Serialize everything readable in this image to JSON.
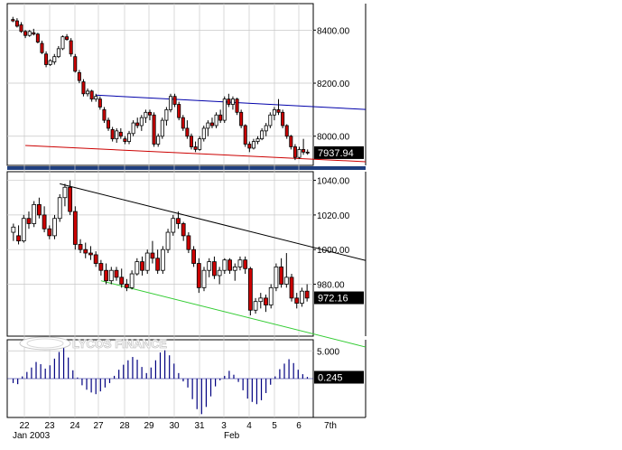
{
  "colors": {
    "background": "#ffffff",
    "grid": "#c8c8c8",
    "bear_candle": "#cc0000",
    "bull_candle": "#ffffff",
    "candle_outline": "#000000",
    "resistance_top": "#0000aa",
    "support_top": "#cc0000",
    "resistance_bottom": "#000000",
    "support_bottom": "#33cc33",
    "oscillator": "#000080",
    "price_tag_bg": "#000000",
    "panel_strip": "#1f3f7f"
  },
  "watermark": {
    "text": "LYCOS FINANCE",
    "icon": "lycos-logo-icon"
  },
  "chart_data": [
    {
      "type": "candlestick",
      "panel": "top",
      "title": "",
      "ylim": [
        7890,
        8500
      ],
      "y_ticks": [
        {
          "v": 8400,
          "label": "8400.00"
        },
        {
          "v": 8200,
          "label": "8200.00"
        },
        {
          "v": 8000,
          "label": "8000.00"
        }
      ],
      "last_value_label": "7937.94",
      "last_value": 7937.94,
      "ohlc": [
        [
          8440,
          8450,
          8430,
          8435
        ],
        [
          8435,
          8445,
          8410,
          8415
        ],
        [
          8420,
          8430,
          8390,
          8395
        ],
        [
          8395,
          8400,
          8370,
          8380
        ],
        [
          8380,
          8400,
          8375,
          8395
        ],
        [
          8390,
          8405,
          8380,
          8385
        ],
        [
          8385,
          8390,
          8350,
          8355
        ],
        [
          8350,
          8360,
          8310,
          8315
        ],
        [
          8310,
          8320,
          8260,
          8270
        ],
        [
          8270,
          8290,
          8265,
          8285
        ],
        [
          8280,
          8310,
          8270,
          8300
        ],
        [
          8300,
          8340,
          8295,
          8330
        ],
        [
          8330,
          8380,
          8325,
          8375
        ],
        [
          8375,
          8385,
          8360,
          8365
        ],
        [
          8360,
          8370,
          8300,
          8310
        ],
        [
          8300,
          8310,
          8240,
          8245
        ],
        [
          8240,
          8250,
          8200,
          8210
        ],
        [
          8205,
          8215,
          8150,
          8160
        ],
        [
          8160,
          8180,
          8150,
          8170
        ],
        [
          8170,
          8175,
          8130,
          8140
        ],
        [
          8140,
          8160,
          8130,
          8150
        ],
        [
          8140,
          8150,
          8100,
          8110
        ],
        [
          8100,
          8110,
          8050,
          8060
        ],
        [
          8060,
          8070,
          8020,
          8030
        ],
        [
          8025,
          8035,
          7980,
          7990
        ],
        [
          7990,
          8030,
          7975,
          8020
        ],
        [
          8015,
          8030,
          7990,
          8000
        ],
        [
          7990,
          8000,
          7970,
          7980
        ],
        [
          7980,
          8020,
          7970,
          8010
        ],
        [
          8010,
          8060,
          8000,
          8050
        ],
        [
          8050,
          8070,
          8030,
          8040
        ],
        [
          8040,
          8080,
          8020,
          8070
        ],
        [
          8070,
          8100,
          8050,
          8090
        ],
        [
          8090,
          8100,
          8060,
          8080
        ],
        [
          8080,
          8090,
          7960,
          7970
        ],
        [
          7970,
          8010,
          7960,
          8000
        ],
        [
          8000,
          8070,
          7990,
          8060
        ],
        [
          8060,
          8110,
          8040,
          8100
        ],
        [
          8100,
          8160,
          8090,
          8150
        ],
        [
          8150,
          8160,
          8110,
          8120
        ],
        [
          8120,
          8130,
          8060,
          8070
        ],
        [
          8070,
          8080,
          8020,
          8030
        ],
        [
          8030,
          8060,
          7990,
          8000
        ],
        [
          8000,
          8010,
          7950,
          7960
        ],
        [
          7960,
          7980,
          7940,
          7950
        ],
        [
          7950,
          8000,
          7945,
          7990
        ],
        [
          7990,
          8040,
          7980,
          8030
        ],
        [
          8030,
          8060,
          8000,
          8050
        ],
        [
          8050,
          8070,
          8030,
          8040
        ],
        [
          8040,
          8090,
          8030,
          8080
        ],
        [
          8080,
          8100,
          8050,
          8060
        ],
        [
          8060,
          8150,
          8050,
          8140
        ],
        [
          8140,
          8160,
          8110,
          8120
        ],
        [
          8120,
          8150,
          8100,
          8140
        ],
        [
          8140,
          8145,
          8080,
          8090
        ],
        [
          8090,
          8100,
          8030,
          8040
        ],
        [
          8040,
          8045,
          7960,
          7970
        ],
        [
          7970,
          7980,
          7940,
          7955
        ],
        [
          7955,
          7990,
          7950,
          7980
        ],
        [
          7980,
          8000,
          7970,
          7990
        ],
        [
          7990,
          8030,
          7985,
          8020
        ],
        [
          8020,
          8050,
          8000,
          8040
        ],
        [
          8040,
          8090,
          8030,
          8080
        ],
        [
          8080,
          8110,
          8060,
          8100
        ],
        [
          8100,
          8140,
          8080,
          8090
        ],
        [
          8090,
          8100,
          8030,
          8040
        ],
        [
          8040,
          8045,
          7990,
          8000
        ],
        [
          8000,
          8005,
          7950,
          7960
        ],
        [
          7960,
          7970,
          7910,
          7920
        ],
        [
          7920,
          7960,
          7915,
          7950
        ],
        [
          7950,
          7990,
          7930,
          7940
        ],
        [
          7940,
          7950,
          7930,
          7938
        ]
      ],
      "trend_lines": [
        {
          "name": "resistance",
          "from": [
            20,
            8155
          ],
          "to": [
            74,
            8110
          ],
          "color": "#0000aa"
        },
        {
          "name": "support",
          "from": [
            3,
            7965
          ],
          "to": [
            74,
            7912
          ],
          "color": "#cc0000"
        }
      ]
    },
    {
      "type": "candlestick",
      "panel": "middle",
      "title": "",
      "ylim": [
        950,
        1045
      ],
      "y_ticks": [
        {
          "v": 1040,
          "label": "1040.00"
        },
        {
          "v": 1020,
          "label": "1020.00"
        },
        {
          "v": 1000,
          "label": "1000.00"
        },
        {
          "v": 980,
          "label": "980.00"
        }
      ],
      "last_value_label": "972.16",
      "last_value": 972.16,
      "ohlc": [
        [
          1010,
          1015,
          1005,
          1013
        ],
        [
          1008,
          1014,
          1003,
          1005
        ],
        [
          1005,
          1020,
          1004,
          1018
        ],
        [
          1018,
          1022,
          1012,
          1015
        ],
        [
          1015,
          1028,
          1013,
          1026
        ],
        [
          1026,
          1030,
          1018,
          1020
        ],
        [
          1020,
          1025,
          1010,
          1012
        ],
        [
          1012,
          1014,
          1006,
          1008
        ],
        [
          1008,
          1020,
          1006,
          1018
        ],
        [
          1018,
          1032,
          1016,
          1030
        ],
        [
          1030,
          1038,
          1025,
          1036
        ],
        [
          1036,
          1040,
          1020,
          1022
        ],
        [
          1022,
          1025,
          1000,
          1003
        ],
        [
          1003,
          1006,
          998,
          1000
        ],
        [
          1000,
          1004,
          995,
          998
        ],
        [
          998,
          1002,
          994,
          997
        ],
        [
          997,
          999,
          990,
          992
        ],
        [
          992,
          994,
          985,
          988
        ],
        [
          988,
          992,
          980,
          982
        ],
        [
          982,
          990,
          980,
          988
        ],
        [
          988,
          990,
          982,
          984
        ],
        [
          984,
          989,
          978,
          980
        ],
        [
          980,
          983,
          976,
          978
        ],
        [
          978,
          988,
          977,
          986
        ],
        [
          986,
          995,
          985,
          993
        ],
        [
          993,
          996,
          985,
          988
        ],
        [
          988,
          1000,
          986,
          998
        ],
        [
          998,
          1005,
          992,
          995
        ],
        [
          995,
          1000,
          986,
          988
        ],
        [
          988,
          1002,
          986,
          1000
        ],
        [
          1000,
          1012,
          998,
          1010
        ],
        [
          1010,
          1020,
          1008,
          1018
        ],
        [
          1018,
          1022,
          1012,
          1015
        ],
        [
          1015,
          1016,
          1005,
          1008
        ],
        [
          1008,
          1010,
          998,
          1000
        ],
        [
          1000,
          1002,
          990,
          992
        ],
        [
          992,
          995,
          975,
          978
        ],
        [
          978,
          990,
          976,
          988
        ],
        [
          988,
          995,
          984,
          993
        ],
        [
          993,
          996,
          983,
          985
        ],
        [
          985,
          990,
          980,
          988
        ],
        [
          988,
          995,
          986,
          994
        ],
        [
          994,
          995,
          986,
          988
        ],
        [
          988,
          992,
          982,
          990
        ],
        [
          990,
          996,
          988,
          994
        ],
        [
          994,
          996,
          986,
          989
        ],
        [
          989,
          990,
          962,
          965
        ],
        [
          965,
          972,
          963,
          970
        ],
        [
          970,
          975,
          966,
          972
        ],
        [
          972,
          974,
          964,
          968
        ],
        [
          968,
          980,
          966,
          978
        ],
        [
          978,
          992,
          976,
          990
        ],
        [
          990,
          995,
          978,
          980
        ],
        [
          980,
          998,
          978,
          984
        ],
        [
          984,
          986,
          970,
          972
        ],
        [
          972,
          975,
          966,
          969
        ],
        [
          969,
          978,
          967,
          976
        ],
        [
          976,
          980,
          970,
          972
        ]
      ],
      "trend_lines": [
        {
          "name": "resistance",
          "from": [
            9,
            1038
          ],
          "to": [
            72,
            991
          ],
          "color": "#000000"
        },
        {
          "name": "support",
          "from": [
            17,
            982
          ],
          "to": [
            72,
            941
          ],
          "color": "#33cc33"
        }
      ]
    },
    {
      "type": "bar",
      "panel": "bottom",
      "title": "",
      "ylim": [
        -7,
        7
      ],
      "y_ticks": [
        {
          "v": 5,
          "label": "5.000"
        }
      ],
      "last_value_label": "0.245",
      "last_value": 0.245,
      "values": [
        -0.8,
        -1.0,
        0.4,
        1.2,
        2.0,
        3.0,
        2.6,
        1.8,
        2.4,
        3.6,
        4.8,
        6.5,
        3.8,
        1.5,
        0.2,
        -1.2,
        -2.0,
        -2.5,
        -2.8,
        -2.3,
        -1.6,
        -0.8,
        0.5,
        1.6,
        2.5,
        3.3,
        3.9,
        3.4,
        2.1,
        1.0,
        2.0,
        3.3,
        4.7,
        5.1,
        4.2,
        2.7,
        1.0,
        -0.5,
        -1.6,
        -3.7,
        -5.5,
        -6.4,
        -5.1,
        -3.2,
        -1.4,
        -0.3,
        0.5,
        1.4,
        0.7,
        -0.6,
        -2.1,
        -3.6,
        -4.2,
        -4.6,
        -3.9,
        -2.6,
        -1.1,
        0.4,
        1.7,
        2.7,
        3.5,
        2.8,
        1.6,
        0.8,
        0.3
      ]
    }
  ],
  "x_axis": {
    "date_labels": [
      "22",
      "23",
      "24",
      "27",
      "28",
      "29",
      "30",
      "31",
      "3",
      "4",
      "5",
      "6",
      "7th"
    ],
    "month_labels": [
      "Jan 2003",
      "Feb"
    ]
  }
}
